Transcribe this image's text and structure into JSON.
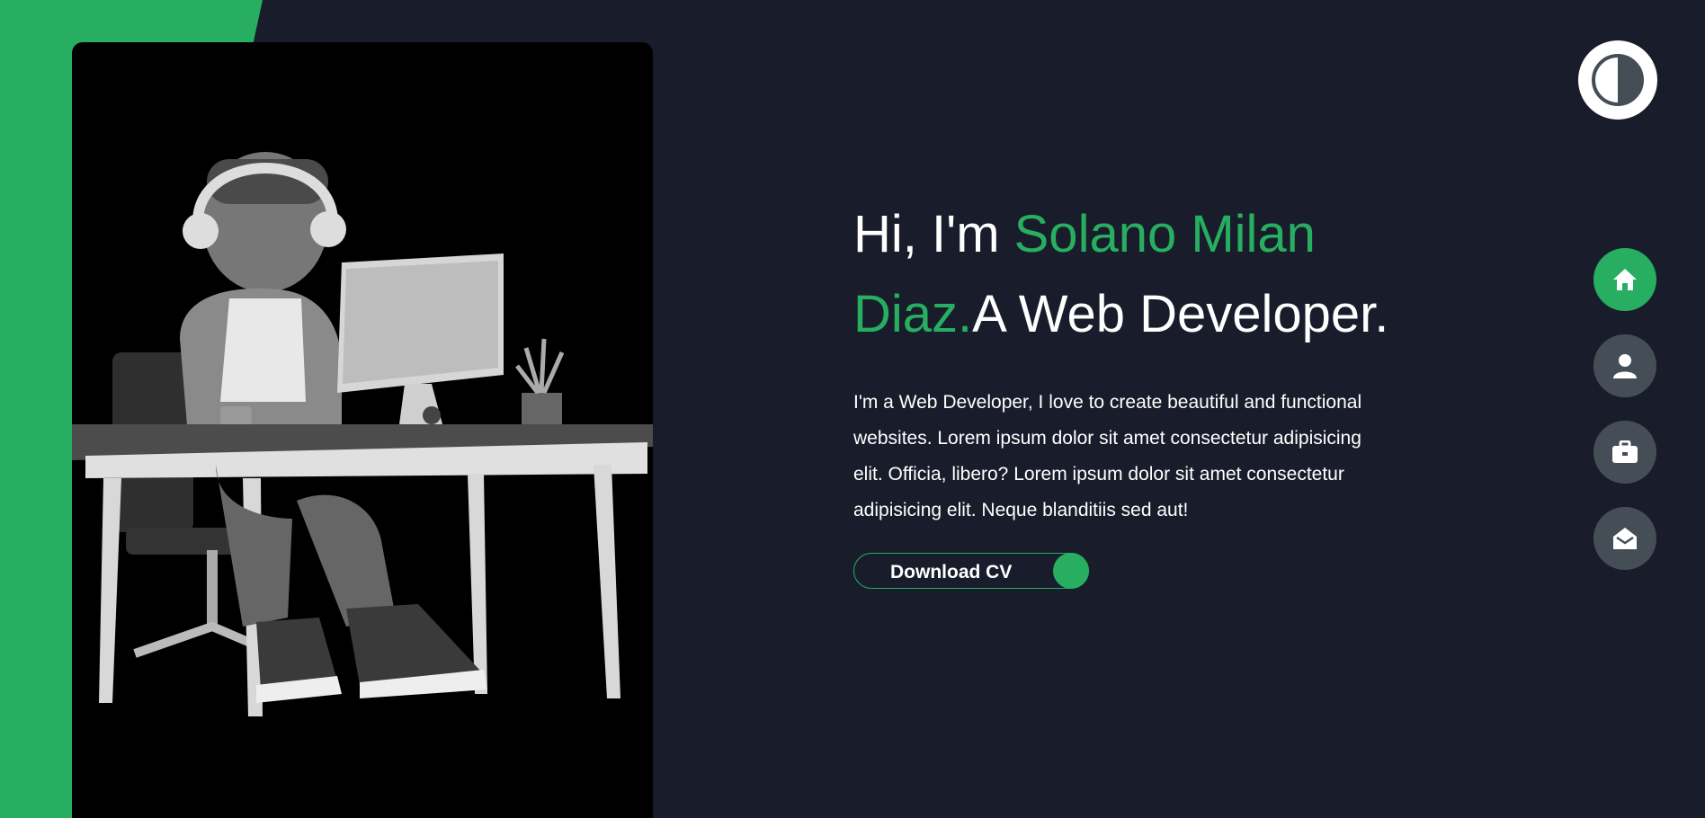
{
  "hero": {
    "greeting": "Hi, I'm ",
    "name": "Solano Milan Diaz.",
    "role": "A Web Developer.",
    "description": "I'm a Web Developer, I love to create beautiful and functional websites. Lorem ipsum dolor sit amet consectetur adipisicing elit. Officia, libero? Lorem ipsum dolor sit amet consectetur adipisicing elit. Neque blanditiis sed aut!",
    "cv_button_label": "Download CV"
  },
  "nav": {
    "items": [
      {
        "icon": "home-icon",
        "active": true
      },
      {
        "icon": "user-icon",
        "active": false
      },
      {
        "icon": "briefcase-icon",
        "active": false
      },
      {
        "icon": "envelope-open-icon",
        "active": false
      }
    ]
  },
  "theme_toggle": {
    "icon": "half-circle-contrast-icon"
  },
  "colors": {
    "accent": "#27ae60",
    "background": "#191d2b",
    "nav_button": "#454e56",
    "text": "#ffffff"
  }
}
